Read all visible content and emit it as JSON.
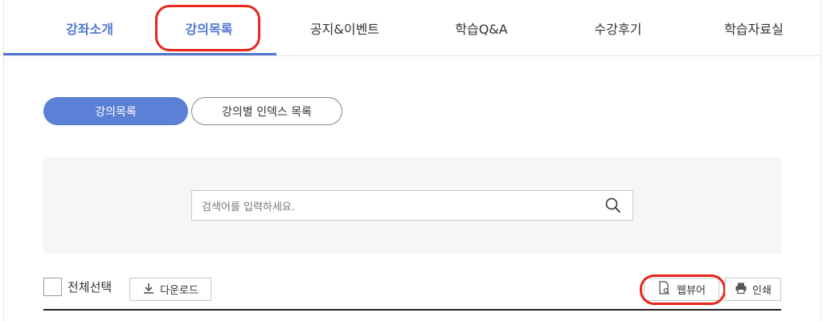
{
  "nav": {
    "tabs": [
      {
        "label": "강좌소개",
        "active": true
      },
      {
        "label": "강의목록",
        "active": false
      },
      {
        "label": "공지&이벤트",
        "active": false
      },
      {
        "label": "학습Q&A",
        "active": false
      },
      {
        "label": "수강후기",
        "active": false
      },
      {
        "label": "학습자료실",
        "active": false
      }
    ]
  },
  "subtabs": {
    "lecture_list": "강의목록",
    "index_list": "강의별 인덱스 목록"
  },
  "search": {
    "placeholder": "검색어를 입력하세요."
  },
  "toolbar": {
    "select_all": "전체선택",
    "download": "다운로드",
    "webviewer": "웹뷰어",
    "print": "인쇄"
  },
  "colors": {
    "accent": "#5278d2",
    "highlight_ring": "#e8261c"
  },
  "icons": [
    "search-icon",
    "download-icon",
    "document-search-icon",
    "printer-icon"
  ]
}
